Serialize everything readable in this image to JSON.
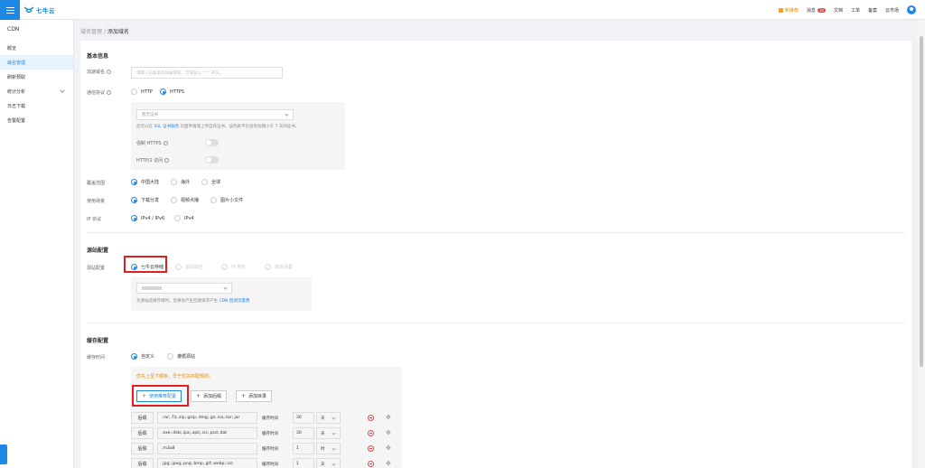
{
  "topbar": {
    "brand": "七牛云",
    "nav": [
      {
        "key": "gift",
        "label": "新推荐"
      },
      {
        "key": "messages",
        "label": "消息",
        "badge": "14"
      },
      {
        "key": "docs",
        "label": "文档"
      },
      {
        "key": "ticket",
        "label": "工单"
      },
      {
        "key": "filing",
        "label": "备案"
      },
      {
        "key": "market",
        "label": "云市场"
      }
    ]
  },
  "sidebar": {
    "title": "CDN",
    "items": [
      {
        "label": "概览",
        "active": false
      },
      {
        "label": "域名管理",
        "active": true
      },
      {
        "label": "刷新预取",
        "active": false
      },
      {
        "label": "统计分析",
        "active": false,
        "expandable": true
      },
      {
        "label": "日志下载",
        "active": false
      },
      {
        "label": "告警配置",
        "active": false
      }
    ]
  },
  "breadcrumb": {
    "parent": "域名管理",
    "sep": "/",
    "current": "添加域名"
  },
  "basic": {
    "title": "基本信息",
    "domain_label": "加速域名",
    "domain_placeholder": "请输入已备案的加速域名，泛域名以 \"*.\" 开头。",
    "protocol_label": "通信协议",
    "protocol_http": "HTTP",
    "protocol_https": "HTTPS",
    "cert_select": "暂无证书",
    "cert_hint_prefix": "您可以在",
    "cert_hint_link": "SSL 证书服务",
    "cert_hint_suffix": "页面申请或上传自有证书。该列表不包含有效期小于 7 天的证书。",
    "force_https": "强制 HTTPS",
    "http2": "HTTP/2 访问",
    "coverage_label": "覆盖范围",
    "coverage_options": [
      "中国大陆",
      "海外",
      "全球"
    ],
    "scenario_label": "使用场景",
    "scenario_options": [
      "下载分发",
      "视频点播",
      "图片小文件"
    ],
    "ip_label": "IP 协议",
    "ip_options": [
      "IPv4 / IPv6",
      "IPv4"
    ]
  },
  "origin": {
    "title": "源站配置",
    "label": "源站配置",
    "options": [
      "七牛云存储",
      "源站域名",
      "IP 地址",
      "高级设置"
    ],
    "hint_prefix": "为源站选择存储时，您将会产生回源请求产生",
    "hint_link": "CDN 回源流量费"
  },
  "cache": {
    "title": "缓存配置",
    "label": "缓存时间",
    "options": [
      "自定义",
      "遵循源站"
    ],
    "warning": "优先上至下顺序，早于优先匹配规则。",
    "buttons": [
      "使用推荐配置",
      "添加后缀",
      "添加目录"
    ],
    "ttl_label": "缓存时间",
    "rows": [
      {
        "type": "后缀",
        "rule": ".rar;.7z;.zip;.gzip;.dmg;.gz;.iso;.tar;.jar",
        "value": "30",
        "unit": "天"
      },
      {
        "type": "后缀",
        "rule": ".exe;.deb;.ipa;.apk;.sis;.psd;.dat",
        "value": "30",
        "unit": "天"
      },
      {
        "type": "后缀",
        "rule": ".m3u8",
        "value": "1",
        "unit": "时"
      },
      {
        "type": "后缀",
        "rule": ".jpg;.jpeg;.png;.bmp;.gif;.webp;.ico",
        "value": "1",
        "unit": "天"
      }
    ]
  }
}
